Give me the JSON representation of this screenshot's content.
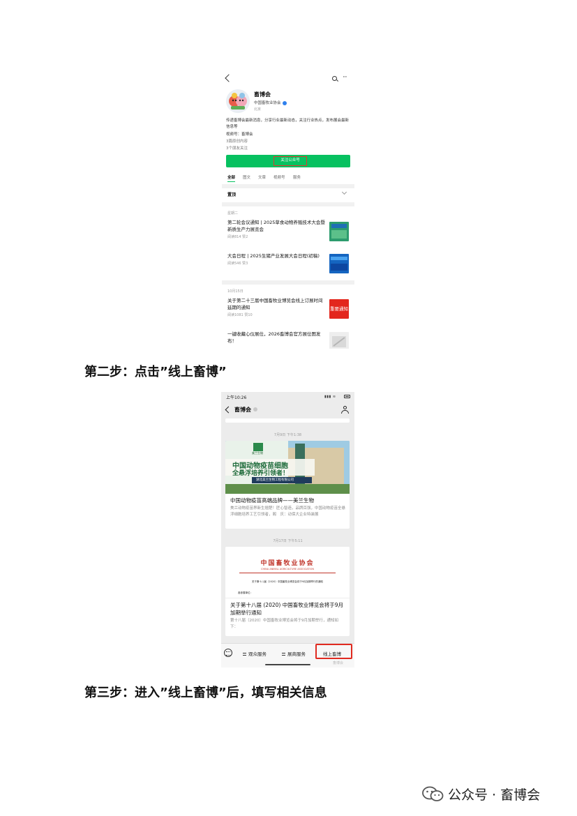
{
  "screenshot1": {
    "account_name": "畜博会",
    "org_name": "中国畜牧业协会",
    "location": "北京",
    "description": "传递畜博会最新消息，分享行业最新动态，关注行业热点，发布展会最新信息等",
    "video_label": "视频号：畜博会",
    "original_count": "3篇原创内容",
    "friends_follow": "3个朋友关注",
    "follow_button": "关注公众号",
    "tabs": [
      "全部",
      "图文",
      "文章",
      "视频号",
      "服务"
    ],
    "pinned_label": "置顶",
    "group1_date": "星期二",
    "articles_group1": [
      {
        "title": "第二轮会议通知 | 2025草食动物养殖技术大会暨新质生产力展览会",
        "stats": "阅读814  赞2"
      },
      {
        "title": "大会日程 | 2025生猪产业发展大会日程(初稿)",
        "stats": "阅读546  赞3"
      }
    ],
    "group2_date": "10月15日",
    "articles_group2": [
      {
        "title": "关于第二十三届中国畜牧业博览会线上订展时间延期的通知",
        "stats": "阅读1081  赞10",
        "thumb_text": "重要通知"
      },
      {
        "title": "一键收藏心仪展位，2026畜博会官方展位图发布！",
        "stats": ""
      }
    ]
  },
  "step2": "第二步：点击”线上畜博”",
  "screenshot2": {
    "status_time": "上午10:26",
    "status_icons": "▮▮▮ ≋",
    "chat_title": "畜博会",
    "stamp1": "7月9日 下午1:38",
    "card1": {
      "banner_logo": "美兰生物",
      "banner_line1": "中国动物疫苗细胞",
      "banner_line2": "全悬浮培养引领者！",
      "banner_company": "湖北美兰生物工程有限公司",
      "title": "中国动物疫苗高端品牌——美兰生物",
      "desc": "美兰动物疫苗界新生翘楚！匠心智造，品牌百强，中国动物疫苗全悬浮细胞培养工艺引领者，阁　庆：动保大企业特装展"
    },
    "stamp2": "7月17日 下午5:11",
    "card2": {
      "header_cn": "中国畜牧业协会",
      "header_en": "CHINA ANIMAL AGRICULTURE ASSOCIATION",
      "doc_line": "关于第十八届（2020）中国畜牧业博览会将于9月加期举行的通知",
      "doc_line2": "各参展单位：",
      "title": "关于第十八届 (2020) 中国畜牧业博览会将于9月加期举行通知",
      "desc": "第十八届（2020）中国畜牧业博览会将于9月加期举行，通知如下："
    },
    "menu": [
      "观众服务",
      "展商服务",
      "线上畜博"
    ],
    "watermark": "畜博会"
  },
  "step3": "第三步：进入”线上畜博”后，填写相关信息",
  "footer": "公众号 · 畜博会",
  "colors": {
    "wechat_green": "#07c160",
    "highlight_red": "#e02a20"
  }
}
